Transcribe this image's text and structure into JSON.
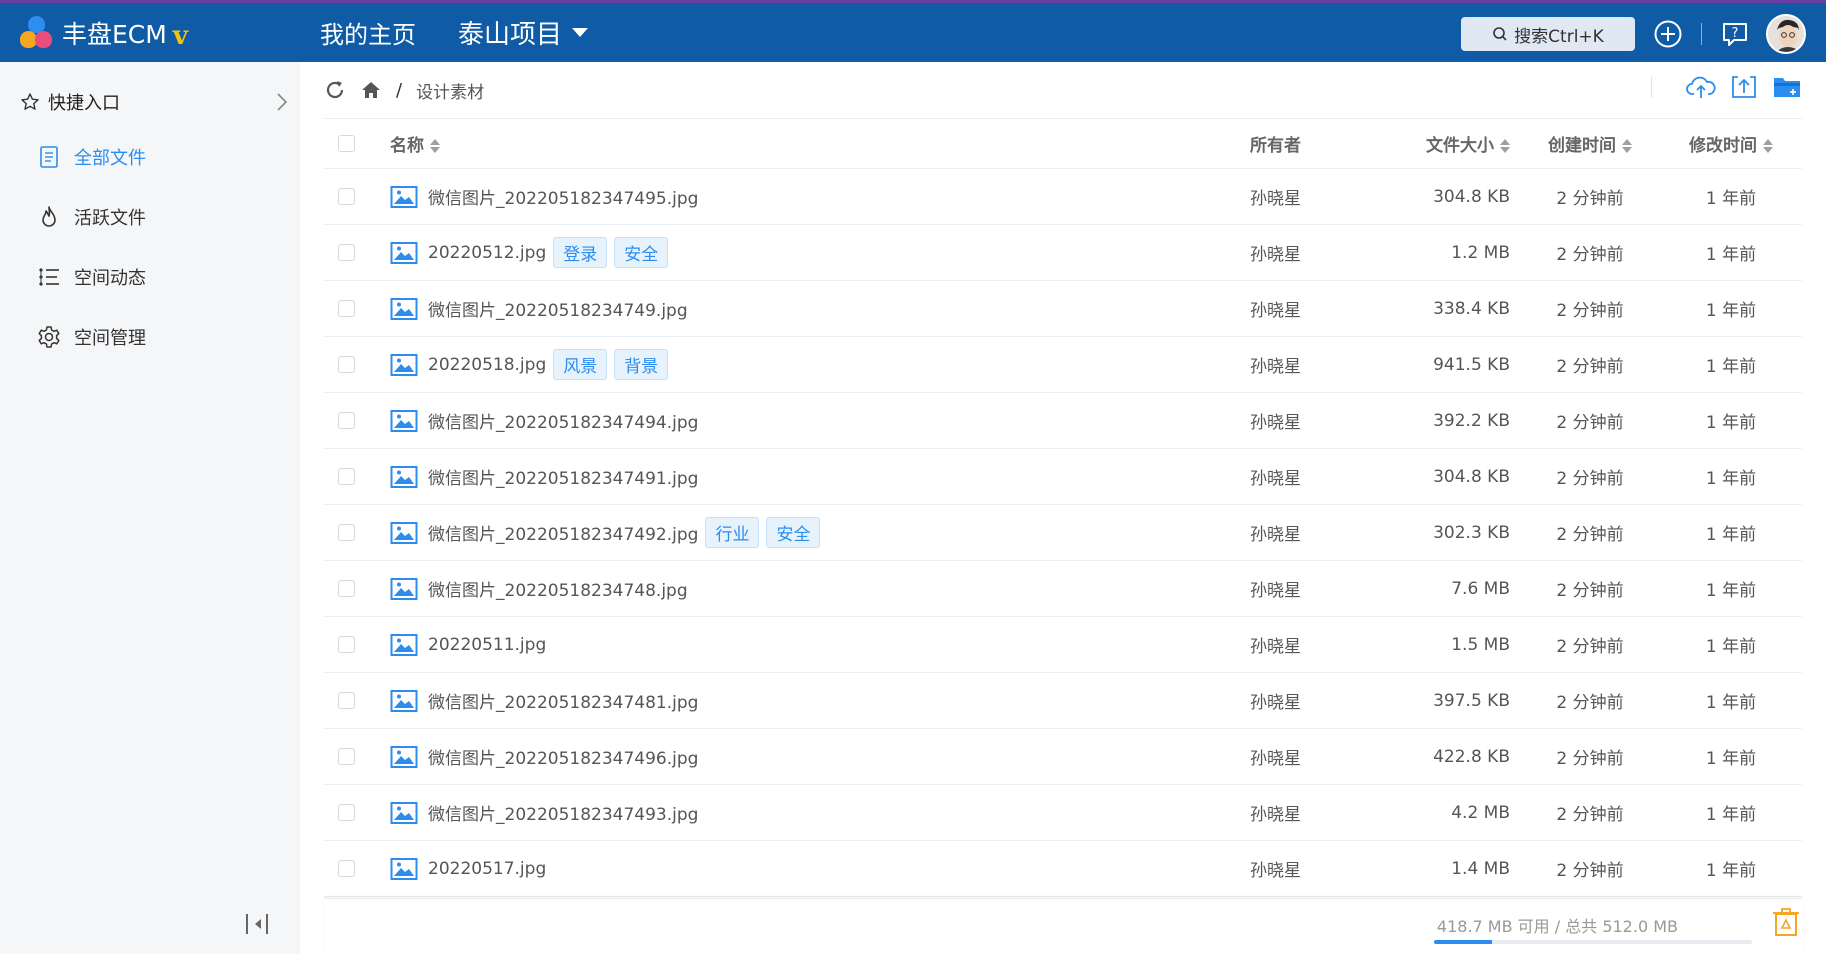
{
  "brand": {
    "name": "丰盘ECM",
    "badge": "v"
  },
  "nav": {
    "home": "我的主页",
    "project": "泰山项目"
  },
  "search": {
    "label": "搜索Ctrl+K"
  },
  "icons": {
    "add": "plus-circle-icon",
    "help": "help-icon",
    "avatar": "avatar",
    "refresh": "refresh-icon",
    "home": "home-icon",
    "upload": "cloud-upload-icon",
    "upload_file": "upload-file-icon",
    "new_folder": "new-folder-icon",
    "recycle": "recycle-bin-icon"
  },
  "colors": {
    "header": "#0f5ba6",
    "accent": "#2d8cf0",
    "tag_bg": "#e6f2fc",
    "recycle": "#f5a623"
  },
  "sidebar": {
    "quick_access": "快捷入口",
    "items": [
      {
        "label": "全部文件",
        "icon": "document-icon",
        "active": true
      },
      {
        "label": "活跃文件",
        "icon": "flame-icon",
        "active": false
      },
      {
        "label": "空间动态",
        "icon": "activity-list-icon",
        "active": false
      },
      {
        "label": "空间管理",
        "icon": "gear-icon",
        "active": false
      }
    ]
  },
  "breadcrumb": {
    "separator": "/",
    "current": "设计素材"
  },
  "table": {
    "columns": {
      "name": "名称",
      "owner": "所有者",
      "size": "文件大小",
      "created": "创建时间",
      "modified": "修改时间"
    },
    "rows": [
      {
        "name": "微信图片_202205182347495.jpg",
        "tags": [],
        "owner": "孙晓星",
        "size": "304.8 KB",
        "created": "2 分钟前",
        "modified": "1 年前"
      },
      {
        "name": "20220512.jpg",
        "tags": [
          "登录",
          "安全"
        ],
        "owner": "孙晓星",
        "size": "1.2 MB",
        "created": "2 分钟前",
        "modified": "1 年前"
      },
      {
        "name": "微信图片_20220518234749.jpg",
        "tags": [],
        "owner": "孙晓星",
        "size": "338.4 KB",
        "created": "2 分钟前",
        "modified": "1 年前"
      },
      {
        "name": "20220518.jpg",
        "tags": [
          "风景",
          "背景"
        ],
        "owner": "孙晓星",
        "size": "941.5 KB",
        "created": "2 分钟前",
        "modified": "1 年前"
      },
      {
        "name": "微信图片_202205182347494.jpg",
        "tags": [],
        "owner": "孙晓星",
        "size": "392.2 KB",
        "created": "2 分钟前",
        "modified": "1 年前"
      },
      {
        "name": "微信图片_202205182347491.jpg",
        "tags": [],
        "owner": "孙晓星",
        "size": "304.8 KB",
        "created": "2 分钟前",
        "modified": "1 年前"
      },
      {
        "name": "微信图片_202205182347492.jpg",
        "tags": [
          "行业",
          "安全"
        ],
        "owner": "孙晓星",
        "size": "302.3 KB",
        "created": "2 分钟前",
        "modified": "1 年前"
      },
      {
        "name": "微信图片_20220518234748.jpg",
        "tags": [],
        "owner": "孙晓星",
        "size": "7.6 MB",
        "created": "2 分钟前",
        "modified": "1 年前"
      },
      {
        "name": "20220511.jpg",
        "tags": [],
        "owner": "孙晓星",
        "size": "1.5 MB",
        "created": "2 分钟前",
        "modified": "1 年前"
      },
      {
        "name": "微信图片_202205182347481.jpg",
        "tags": [],
        "owner": "孙晓星",
        "size": "397.5 KB",
        "created": "2 分钟前",
        "modified": "1 年前"
      },
      {
        "name": "微信图片_202205182347496.jpg",
        "tags": [],
        "owner": "孙晓星",
        "size": "422.8 KB",
        "created": "2 分钟前",
        "modified": "1 年前"
      },
      {
        "name": "微信图片_202205182347493.jpg",
        "tags": [],
        "owner": "孙晓星",
        "size": "4.2 MB",
        "created": "2 分钟前",
        "modified": "1 年前"
      },
      {
        "name": "20220517.jpg",
        "tags": [],
        "owner": "孙晓星",
        "size": "1.4 MB",
        "created": "2 分钟前",
        "modified": "1 年前"
      }
    ]
  },
  "storage": {
    "text": "418.7 MB 可用 / 总共 512.0 MB",
    "used_fraction": 0.182
  }
}
